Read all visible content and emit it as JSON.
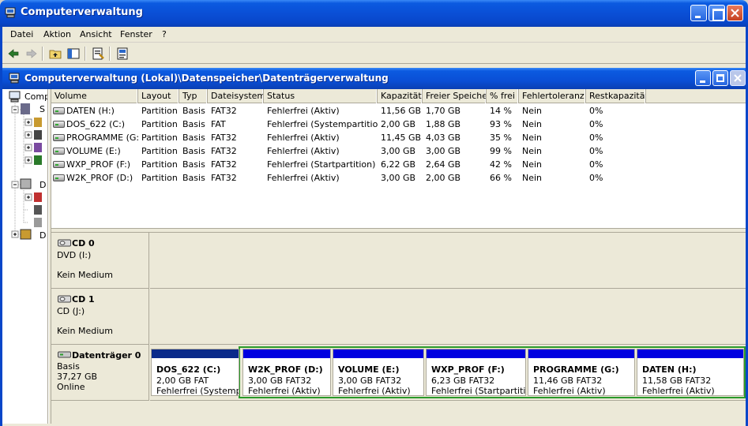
{
  "window": {
    "title": "Computerverwaltung"
  },
  "menu": [
    "Datei",
    "Aktion",
    "Ansicht",
    "Fenster",
    "?"
  ],
  "inner_window": {
    "title": "Computerverwaltung (Lokal)\\Datenspeicher\\Datenträgerverwaltung"
  },
  "tree": {
    "root": "Comp",
    "item_s": "S",
    "item_d": "D",
    "item_d2": "D"
  },
  "table": {
    "columns": [
      "Volume",
      "Layout",
      "Typ",
      "Dateisystem",
      "Status",
      "Kapazität",
      "Freier Speicher",
      "% frei",
      "Fehlertoleranz",
      "Restkapazität"
    ],
    "rows": [
      [
        "DATEN (H:)",
        "Partition",
        "Basis",
        "FAT32",
        "Fehlerfrei (Aktiv)",
        "11,56 GB",
        "1,70 GB",
        "14 %",
        "Nein",
        "0%"
      ],
      [
        "DOS_622 (C:)",
        "Partition",
        "Basis",
        "FAT",
        "Fehlerfrei (Systempartition)",
        "2,00 GB",
        "1,88 GB",
        "93 %",
        "Nein",
        "0%"
      ],
      [
        "PROGRAMME (G:)",
        "Partition",
        "Basis",
        "FAT32",
        "Fehlerfrei (Aktiv)",
        "11,45 GB",
        "4,03 GB",
        "35 %",
        "Nein",
        "0%"
      ],
      [
        "VOLUME (E:)",
        "Partition",
        "Basis",
        "FAT32",
        "Fehlerfrei (Aktiv)",
        "3,00 GB",
        "3,00 GB",
        "99 %",
        "Nein",
        "0%"
      ],
      [
        "WXP_PROF (F:)",
        "Partition",
        "Basis",
        "FAT32",
        "Fehlerfrei (Startpartition)",
        "6,22 GB",
        "2,64 GB",
        "42 %",
        "Nein",
        "0%"
      ],
      [
        "W2K_PROF (D:)",
        "Partition",
        "Basis",
        "FAT32",
        "Fehlerfrei (Aktiv)",
        "3,00 GB",
        "2,00 GB",
        "66 %",
        "Nein",
        "0%"
      ]
    ]
  },
  "disks": [
    {
      "name": "CD 0",
      "line2": "DVD (I:)",
      "line3": "Kein Medium"
    },
    {
      "name": "CD 1",
      "line2": "CD (J:)",
      "line3": "Kein Medium"
    },
    {
      "name": "Datenträger 0",
      "line2": "Basis",
      "line3": "37,27 GB",
      "line4": "Online",
      "partitions": [
        {
          "name": "DOS_622  (C:)",
          "size": "2,00 GB FAT",
          "status": "Fehlerfrei (Systempartition)",
          "bar_color": "#0a2a8a"
        },
        {
          "name": "W2K_PROF  (D:)",
          "size": "3,00 GB FAT32",
          "status": "Fehlerfrei (Aktiv)",
          "bar_color": "#0000e0"
        },
        {
          "name": "VOLUME  (E:)",
          "size": "3,00 GB FAT32",
          "status": "Fehlerfrei (Aktiv)",
          "bar_color": "#0000e0"
        },
        {
          "name": "WXP_PROF  (F:)",
          "size": "6,23 GB FAT32",
          "status": "Fehlerfrei (Startpartition)",
          "bar_color": "#0000e0"
        },
        {
          "name": "PROGRAMME  (G:)",
          "size": "11,46 GB FAT32",
          "status": "Fehlerfrei (Aktiv)",
          "bar_color": "#0000e0"
        },
        {
          "name": "DATEN  (H:)",
          "size": "11,58 GB FAT32",
          "status": "Fehlerfrei (Aktiv)",
          "bar_color": "#0000e0"
        }
      ]
    }
  ],
  "colors": {
    "extended_partition_frame": "#2a9a2a",
    "primary_bar": "#0a2a8a",
    "logical_bar": "#0000e0"
  }
}
